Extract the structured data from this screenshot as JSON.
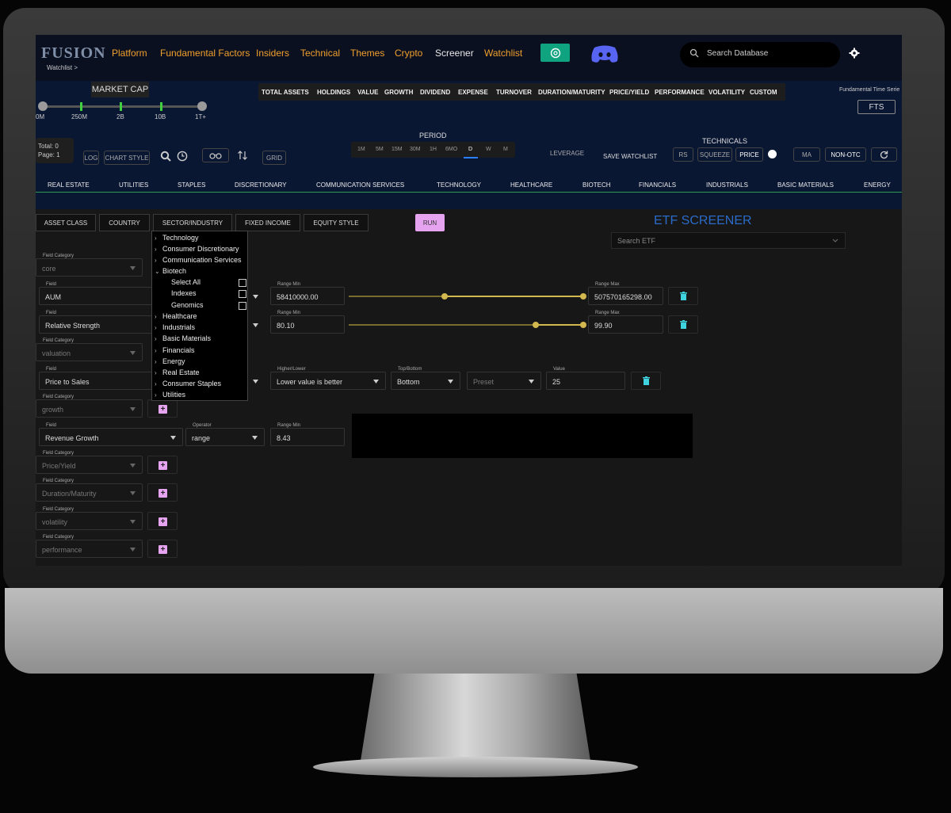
{
  "nav": {
    "logo": "FUSION",
    "sub": "Watchlist >",
    "links": [
      "Platform",
      "Fundamental Factors",
      "Insiders",
      "Technical",
      "Themes",
      "Crypto",
      "Screener",
      "Watchlist"
    ],
    "search_placeholder": "Search Database"
  },
  "market_cap": {
    "label": "MARKET CAP",
    "ticks": [
      "0M",
      "250M",
      "2B",
      "10B",
      "1T+"
    ]
  },
  "categories": [
    "TOTAL ASSETS",
    "HOLDINGS",
    "VALUE",
    "GROWTH",
    "DIVIDEND",
    "EXPENSE",
    "TURNOVER",
    "DURATION/MATURITY",
    "PRICE/YIELD",
    "PERFORMANCE",
    "VOLATILITY",
    "CUSTOM"
  ],
  "fts": {
    "label": "Fundamental Time Serie",
    "button": "FTS"
  },
  "totals": {
    "total": "Total: 0",
    "page": "Page: 1"
  },
  "tools": {
    "log": "LOG",
    "chart_style": "CHART STYLE",
    "grid": "GRID"
  },
  "period": {
    "label": "PERIOD",
    "items": [
      "1M",
      "5M",
      "15M",
      "30M",
      "1H",
      "6MO",
      "D",
      "W",
      "M"
    ],
    "selected": "D"
  },
  "leverage": "LEVERAGE",
  "save_watchlist": "SAVE WATCHLIST",
  "technicals": {
    "label": "TECHNICALS",
    "buttons": [
      "RS",
      "SQUEEZE",
      "PRICE",
      "MA",
      "NON-OTC"
    ]
  },
  "sectors": [
    "REAL ESTATE",
    "UTILITIES",
    "STAPLES",
    "DISCRETIONARY",
    "COMMUNICATION SERVICES",
    "TECHNOLOGY",
    "HEALTHCARE",
    "BIOTECH",
    "FINANCIALS",
    "INDUSTRIALS",
    "BASIC MATERIALS",
    "ENERGY"
  ],
  "screener_tabs": [
    "ASSET CLASS",
    "COUNTRY",
    "SECTOR/INDUSTRY",
    "FIXED INCOME",
    "EQUITY STYLE"
  ],
  "run": "RUN",
  "etf_title": "ETF SCREENER",
  "search_etf_placeholder": "Search ETF",
  "labels": {
    "field_category": "Field Category",
    "field": "Field",
    "range_min": "Range Min",
    "range_max": "Range Max",
    "higher_lower": "Higher/Lower",
    "top_bottom": "Top/Bottom",
    "value": "Value",
    "operator": "Operator"
  },
  "rows": {
    "cat_core": "core",
    "aum": {
      "field": "AUM",
      "min": "58410000.00",
      "max": "507570165298.00"
    },
    "rs": {
      "field": "Relative Strength",
      "min": "80.10",
      "max": "99.90"
    },
    "cat_valuation": "valuation",
    "ps": {
      "field": "Price to Sales",
      "higher_lower": "Lower value is better",
      "top_bottom": "Bottom",
      "preset": "Preset",
      "value": "25"
    },
    "cat_growth": "growth",
    "rev": {
      "field": "Revenue Growth",
      "operator": "range",
      "min": "8.43"
    },
    "cat_price_yield": "Price/Yield",
    "cat_duration": "Duration/Maturity",
    "cat_volatility": "volatility",
    "cat_performance": "performance"
  },
  "dropdown": {
    "items_top": [
      "Technology",
      "Consumer Discretionary",
      "Communication Services",
      "Biotech"
    ],
    "biotech_sub": [
      "Select All",
      "Indexes",
      "Genomics"
    ],
    "items_bottom": [
      "Healthcare",
      "Industrials",
      "Basic Materials",
      "Financials",
      "Energy",
      "Real Estate",
      "Consumer Staples",
      "Utilities"
    ]
  },
  "colors": {
    "accent_orange": "#f0a02c",
    "etf_title_blue": "#2a6bc9",
    "run_pink": "#e6a3f0",
    "slider_gold": "#d2b84f",
    "marketcap_tick_green": "#3fd13f",
    "trash_cyan": "#3fd3e0"
  }
}
